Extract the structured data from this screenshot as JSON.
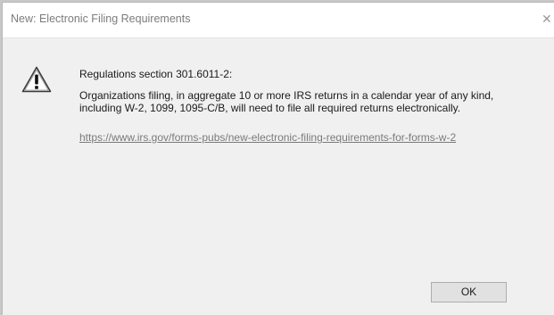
{
  "window": {
    "title": "New: Electronic Filing Requirements",
    "close_glyph": "✕"
  },
  "message": {
    "icon": "warning-icon",
    "heading": "Regulations section 301.6011-2:",
    "body_line1": "Organizations filing, in aggregate 10 or more IRS returns in a calendar year of any kind,",
    "body_line2": "including W-2, 1099, 1095-C/B, will need to file all required returns electronically.",
    "link_text": "https://www.irs.gov/forms-pubs/new-electronic-filing-requirements-for-forms-w-2"
  },
  "buttons": {
    "ok_label": "OK"
  }
}
